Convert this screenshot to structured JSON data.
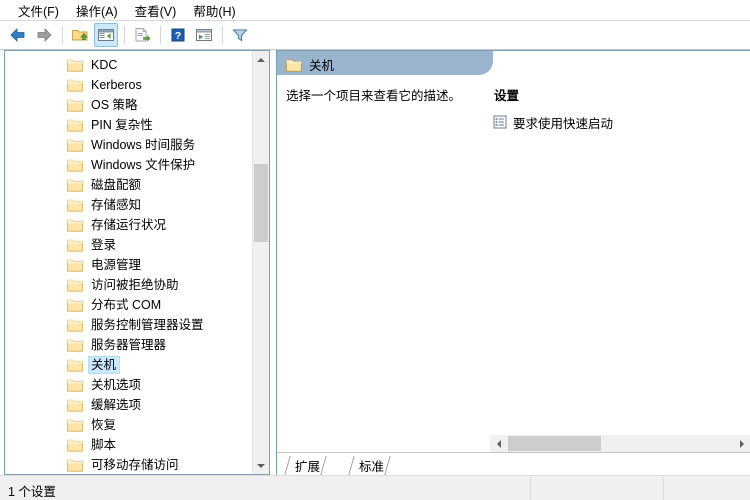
{
  "menubar": {
    "items": [
      {
        "label": "文件(F)",
        "name": "menu-file"
      },
      {
        "label": "操作(A)",
        "name": "menu-action"
      },
      {
        "label": "查看(V)",
        "name": "menu-view"
      },
      {
        "label": "帮助(H)",
        "name": "menu-help"
      }
    ]
  },
  "toolbar": {
    "buttons": [
      {
        "icon": "back-arrow-icon",
        "label": "后退"
      },
      {
        "icon": "forward-arrow-icon",
        "label": "前进"
      },
      {
        "icon": "up-folder-icon",
        "label": "向上一级"
      },
      {
        "icon": "show-tree-icon",
        "label": "显示/隐藏控制台树"
      },
      {
        "icon": "export-list-icon",
        "label": "导出列表"
      },
      {
        "icon": "help-icon",
        "label": "帮助"
      },
      {
        "icon": "filter-view-icon",
        "label": "筛选视图"
      },
      {
        "icon": "filter-icon",
        "label": "筛选器"
      }
    ]
  },
  "tree": {
    "items": [
      {
        "label": "KDC",
        "expandable": false,
        "selected": false
      },
      {
        "label": "Kerberos",
        "expandable": false,
        "selected": false
      },
      {
        "label": "OS 策略",
        "expandable": false,
        "selected": false
      },
      {
        "label": "PIN 复杂性",
        "expandable": false,
        "selected": false
      },
      {
        "label": "Windows 时间服务",
        "expandable": true,
        "selected": false
      },
      {
        "label": "Windows 文件保护",
        "expandable": false,
        "selected": false
      },
      {
        "label": "磁盘配额",
        "expandable": false,
        "selected": false
      },
      {
        "label": "存储感知",
        "expandable": false,
        "selected": false
      },
      {
        "label": "存储运行状况",
        "expandable": false,
        "selected": false
      },
      {
        "label": "登录",
        "expandable": false,
        "selected": false
      },
      {
        "label": "电源管理",
        "expandable": true,
        "selected": false
      },
      {
        "label": "访问被拒绝协助",
        "expandable": false,
        "selected": false
      },
      {
        "label": "分布式 COM",
        "expandable": true,
        "selected": false
      },
      {
        "label": "服务控制管理器设置",
        "expandable": true,
        "selected": false
      },
      {
        "label": "服务器管理器",
        "expandable": false,
        "selected": false
      },
      {
        "label": "关机",
        "expandable": false,
        "selected": true
      },
      {
        "label": "关机选项",
        "expandable": false,
        "selected": false
      },
      {
        "label": "缓解选项",
        "expandable": false,
        "selected": false
      },
      {
        "label": "恢复",
        "expandable": false,
        "selected": false
      },
      {
        "label": "脚本",
        "expandable": false,
        "selected": false
      },
      {
        "label": "可移动存储访问",
        "expandable": false,
        "selected": false
      }
    ],
    "scrollbar": {
      "up_arrow": "scroll-up-icon",
      "down_arrow": "scroll-down-icon"
    }
  },
  "right_pane": {
    "header_title": "关机",
    "header_icon": "folder-icon",
    "description": "选择一个项目来查看它的描述。",
    "settings_heading": "设置",
    "settings": [
      {
        "label": "要求使用快速启动",
        "icon": "policy-setting-icon"
      }
    ],
    "h_scrollbar": {
      "left_arrow": "scroll-left-icon",
      "right_arrow": "scroll-right-icon"
    },
    "tabs": [
      {
        "label": "扩展",
        "active": true
      },
      {
        "label": "标准",
        "active": false
      }
    ]
  },
  "statusbar": {
    "text": "1 个设置"
  },
  "colors": {
    "header_blue": "#9bb4cd",
    "selection_blue": "#cce8ff",
    "pane_border": "#7a9fb8",
    "folder_fill": "#ffe5a8",
    "folder_edge": "#d8b25a",
    "scroll_thumb": "#cdcdcd",
    "statusbar_bg": "#f0f0f0"
  }
}
